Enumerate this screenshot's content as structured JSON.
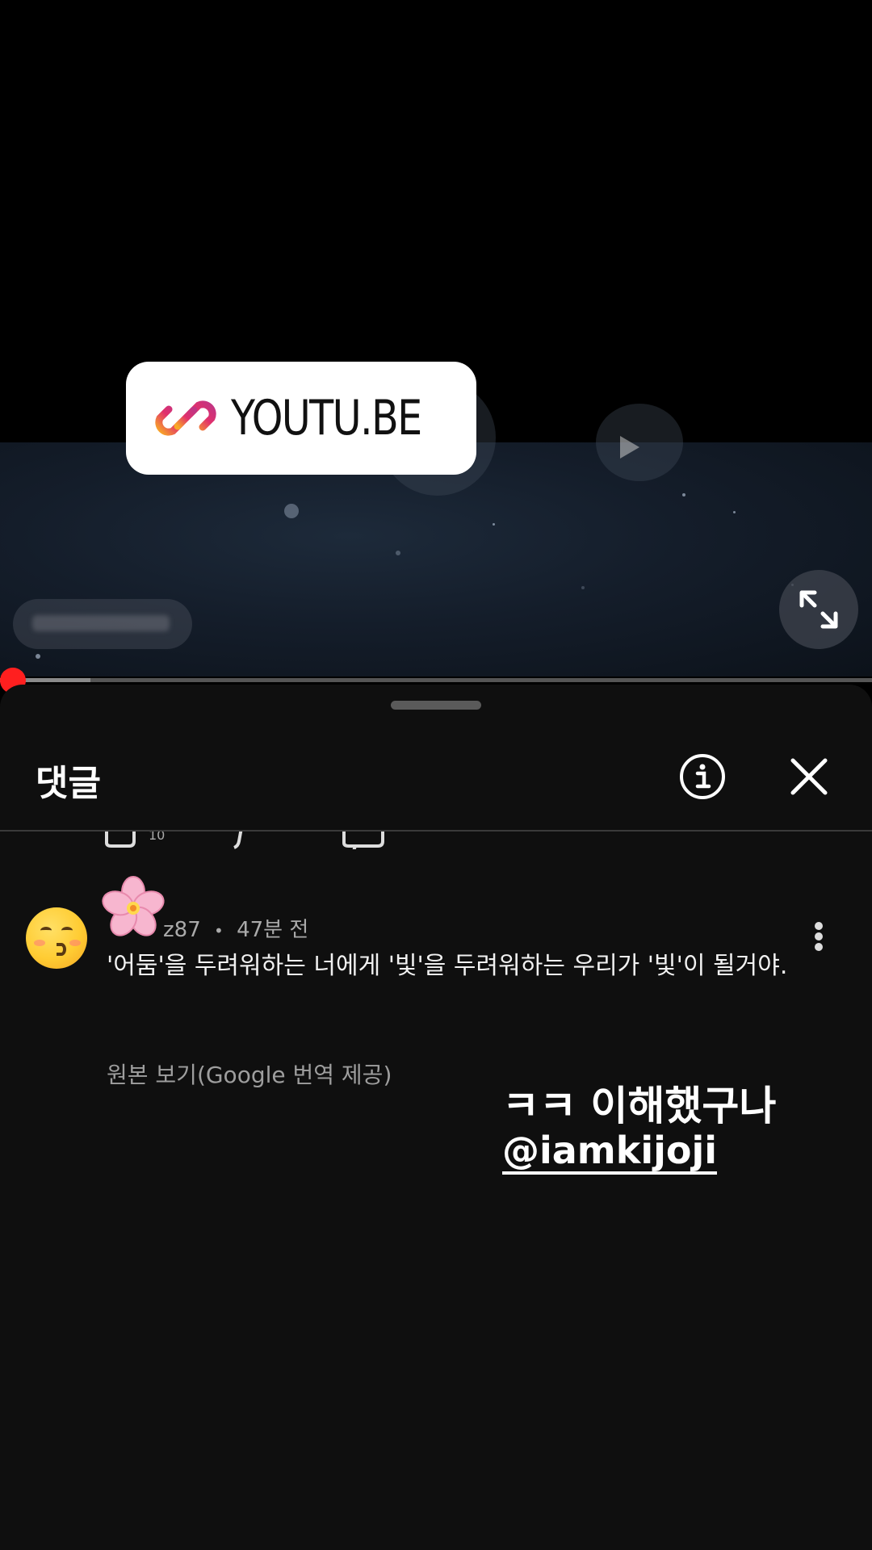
{
  "link_sticker": {
    "text": "YOUTU.BE",
    "icon": "link-icon",
    "gradient_colors": [
      "#f9a826",
      "#e1306c",
      "#c13584"
    ]
  },
  "video_player": {
    "progress_fraction": 0.0,
    "colors": {
      "progress_knob": "#ff1f1f",
      "track": "#555555"
    },
    "expand_icon": "fullscreen-expand-icon"
  },
  "comments_sheet": {
    "title": "댓글",
    "info_icon": "info-icon",
    "close_icon": "close-icon"
  },
  "comment": {
    "avatar_emoji": "😙",
    "username_decoration": "🌸",
    "username_visible": "z87",
    "separator": "•",
    "time": "47분 전",
    "text": "'어둠'을 두려워하는 너에게 '빛'을 두려워하는 우리가 '빛'이 될거야.",
    "translate_link": "원본 보기(Google 번역 제공)",
    "more_icon": "more-vertical-icon"
  },
  "story_overlay": {
    "text": "ㅋㅋ 이해했구나",
    "mention": "@iamkijoji"
  }
}
